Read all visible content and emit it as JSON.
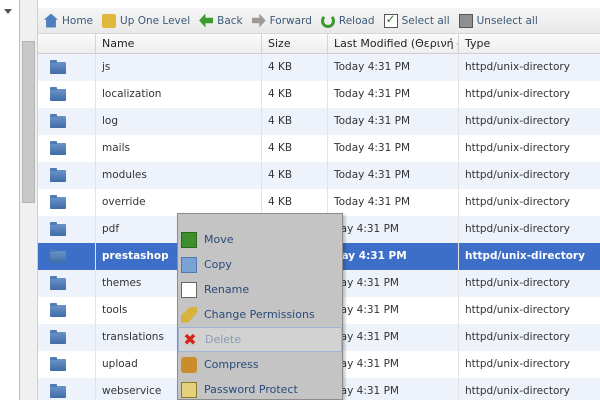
{
  "toolbar": {
    "home": "Home",
    "up": "Up One Level",
    "back": "Back",
    "forward": "Forward",
    "reload": "Reload",
    "select_all": "Select all",
    "unselect_all": "Unselect all"
  },
  "table": {
    "headers": [
      "Name",
      "Size",
      "Last Modified (Θερινή ώρ",
      "Type"
    ],
    "rows": [
      {
        "name": "js",
        "size": "4 KB",
        "modified": "Today 4:31 PM",
        "type": "httpd/unix-directory"
      },
      {
        "name": "localization",
        "size": "4 KB",
        "modified": "Today 4:31 PM",
        "type": "httpd/unix-directory"
      },
      {
        "name": "log",
        "size": "4 KB",
        "modified": "Today 4:31 PM",
        "type": "httpd/unix-directory"
      },
      {
        "name": "mails",
        "size": "4 KB",
        "modified": "Today 4:31 PM",
        "type": "httpd/unix-directory"
      },
      {
        "name": "modules",
        "size": "4 KB",
        "modified": "Today 4:31 PM",
        "type": "httpd/unix-directory"
      },
      {
        "name": "override",
        "size": "4 KB",
        "modified": "Today 4:31 PM",
        "type": "httpd/unix-directory"
      },
      {
        "name": "pdf",
        "size": "",
        "modified": "day 4:31 PM",
        "type": "httpd/unix-directory"
      },
      {
        "name": "prestashop",
        "size": "",
        "modified": "day 4:31 PM",
        "type": "httpd/unix-directory"
      },
      {
        "name": "themes",
        "size": "",
        "modified": "day 4:31 PM",
        "type": "httpd/unix-directory"
      },
      {
        "name": "tools",
        "size": "",
        "modified": "day 4:31 PM",
        "type": "httpd/unix-directory"
      },
      {
        "name": "translations",
        "size": "",
        "modified": "day 4:31 PM",
        "type": "httpd/unix-directory"
      },
      {
        "name": "upload",
        "size": "",
        "modified": "day 4:31 PM",
        "type": "httpd/unix-directory"
      },
      {
        "name": "webservice",
        "size": "",
        "modified": "day 4:31 PM",
        "type": "httpd/unix-directory"
      }
    ],
    "selected_index": 7
  },
  "context_menu": {
    "move": "Move",
    "copy": "Copy",
    "rename": "Rename",
    "change_permissions": "Change Permissions",
    "delete": "Delete",
    "compress": "Compress",
    "password_protect": "Password Protect"
  }
}
